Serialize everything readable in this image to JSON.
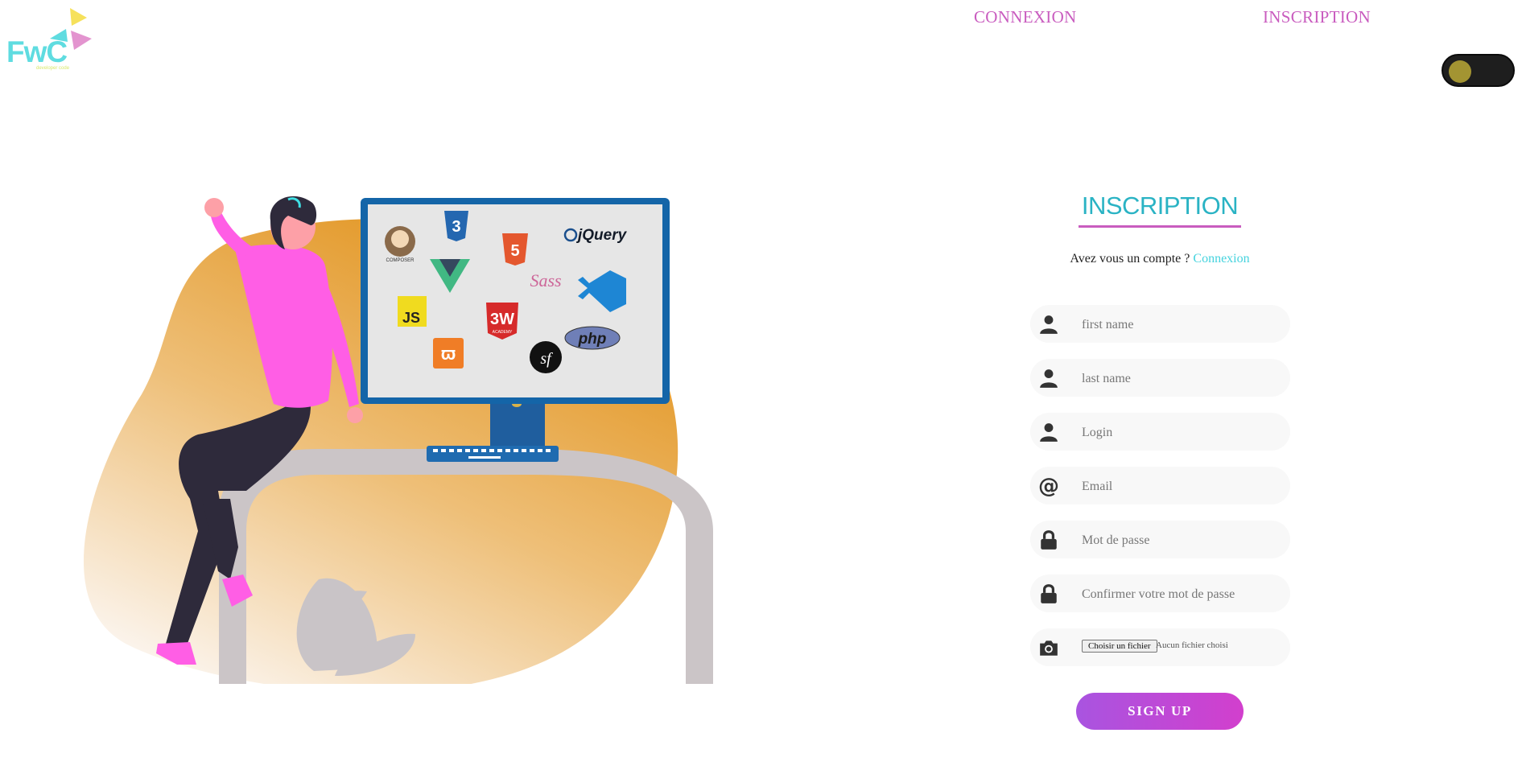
{
  "logo": {
    "text": "FwC",
    "tagline": "developer code"
  },
  "nav": {
    "login": "CONNEXION",
    "register": "INSCRIPTION"
  },
  "theme_toggle": {
    "state": "dark"
  },
  "form": {
    "title": "INSCRIPTION",
    "have_account": "Avez vous un compte ?",
    "login_link": "Connexion",
    "fields": {
      "first_name": {
        "placeholder": "first name",
        "icon": "user-icon"
      },
      "last_name": {
        "placeholder": "last name",
        "icon": "user-icon"
      },
      "login": {
        "placeholder": "Login",
        "icon": "user-icon"
      },
      "email": {
        "placeholder": "Email",
        "icon": "at-icon"
      },
      "password": {
        "placeholder": "Mot de passe",
        "icon": "lock-icon"
      },
      "confirm_password": {
        "placeholder": "Confirmer votre mot de passe",
        "icon": "lock-icon"
      },
      "avatar": {
        "button": "Choisir un fichier",
        "status": "Aucun fichier choisi",
        "icon": "camera-icon"
      }
    },
    "submit": "SIGN UP"
  },
  "illustration": {
    "screen_labels": [
      "jQuery",
      "JS",
      "3W",
      "ACADEMY",
      "php",
      "COMPOSER"
    ]
  },
  "colors": {
    "accent_pink": "#c95cbf",
    "accent_teal": "#2ab3c4",
    "button_gradient_start": "#a954e0",
    "button_gradient_end": "#d23fcd"
  }
}
